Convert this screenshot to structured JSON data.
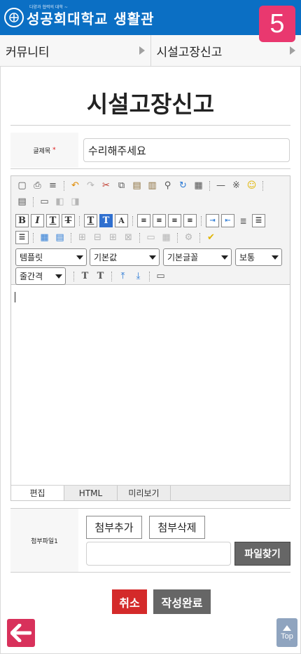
{
  "header": {
    "logo_text": "성공회대학교 생활관",
    "logo_tagline": "다양과 협력의 대학 ~",
    "step_number": "5",
    "brand_color": "#0b6fc4",
    "badge_color": "#e9386f"
  },
  "breadcrumb": {
    "items": [
      {
        "label": "커뮤니티"
      },
      {
        "label": "시설고장신고"
      }
    ]
  },
  "page": {
    "title": "시설고장신고"
  },
  "form": {
    "subject_label": "글제목",
    "required_mark": "*",
    "subject_value": "수리해주세요",
    "editor": {
      "toolbar_row1_icons": [
        "new-doc-icon",
        "print-icon",
        "page-break-icon",
        "undo-icon",
        "redo-icon",
        "cut-icon",
        "copy-icon",
        "paste-icon",
        "paste-text-icon",
        "find-icon",
        "replace-icon",
        "select-all-icon",
        "horizontal-rule-icon",
        "special-char-icon",
        "emoticon-icon"
      ],
      "toolbar_row2_icons": [
        "source-icon",
        "div-icon",
        "layer-icon",
        "layer-copy-icon"
      ],
      "format_buttons": {
        "bold": "B",
        "italic": "I",
        "underline": "T",
        "strike": "T",
        "text_color": "T",
        "bg_color": "T",
        "clear_format": "A"
      },
      "selects": {
        "template": "템플릿",
        "style": "기본값",
        "font": "기본글꼴",
        "size": "보통",
        "line_height": "줄간격"
      },
      "script_buttons": {
        "subscript": "T",
        "superscript": "T"
      },
      "tabs": [
        {
          "label": "편집"
        },
        {
          "label": "HTML"
        },
        {
          "label": "미리보기"
        }
      ]
    },
    "attachment": {
      "label": "첨부파일1",
      "add_label": "첨부추가",
      "remove_label": "첨부삭제",
      "browse_label": "파일찾기"
    },
    "actions": {
      "cancel_label": "취소",
      "submit_label": "작성완료"
    }
  },
  "footer": {
    "top_label": "Top"
  }
}
